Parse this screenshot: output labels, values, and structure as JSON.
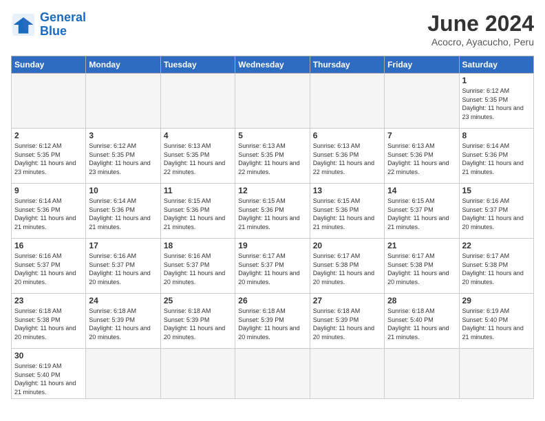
{
  "header": {
    "logo_general": "General",
    "logo_blue": "Blue",
    "title": "June 2024",
    "subtitle": "Acocro, Ayacucho, Peru"
  },
  "days_of_week": [
    "Sunday",
    "Monday",
    "Tuesday",
    "Wednesday",
    "Thursday",
    "Friday",
    "Saturday"
  ],
  "weeks": [
    [
      {
        "day": null,
        "sunrise": null,
        "sunset": null,
        "daylight": null
      },
      {
        "day": null,
        "sunrise": null,
        "sunset": null,
        "daylight": null
      },
      {
        "day": null,
        "sunrise": null,
        "sunset": null,
        "daylight": null
      },
      {
        "day": null,
        "sunrise": null,
        "sunset": null,
        "daylight": null
      },
      {
        "day": null,
        "sunrise": null,
        "sunset": null,
        "daylight": null
      },
      {
        "day": null,
        "sunrise": null,
        "sunset": null,
        "daylight": null
      },
      {
        "day": "1",
        "sunrise": "6:12 AM",
        "sunset": "5:35 PM",
        "daylight": "11 hours and 23 minutes."
      }
    ],
    [
      {
        "day": "2",
        "sunrise": "6:12 AM",
        "sunset": "5:35 PM",
        "daylight": "11 hours and 23 minutes."
      },
      {
        "day": "3",
        "sunrise": "6:12 AM",
        "sunset": "5:35 PM",
        "daylight": "11 hours and 23 minutes."
      },
      {
        "day": "4",
        "sunrise": "6:13 AM",
        "sunset": "5:35 PM",
        "daylight": "11 hours and 22 minutes."
      },
      {
        "day": "5",
        "sunrise": "6:13 AM",
        "sunset": "5:35 PM",
        "daylight": "11 hours and 22 minutes."
      },
      {
        "day": "6",
        "sunrise": "6:13 AM",
        "sunset": "5:36 PM",
        "daylight": "11 hours and 22 minutes."
      },
      {
        "day": "7",
        "sunrise": "6:13 AM",
        "sunset": "5:36 PM",
        "daylight": "11 hours and 22 minutes."
      },
      {
        "day": "8",
        "sunrise": "6:14 AM",
        "sunset": "5:36 PM",
        "daylight": "11 hours and 21 minutes."
      }
    ],
    [
      {
        "day": "9",
        "sunrise": "6:14 AM",
        "sunset": "5:36 PM",
        "daylight": "11 hours and 21 minutes."
      },
      {
        "day": "10",
        "sunrise": "6:14 AM",
        "sunset": "5:36 PM",
        "daylight": "11 hours and 21 minutes."
      },
      {
        "day": "11",
        "sunrise": "6:15 AM",
        "sunset": "5:36 PM",
        "daylight": "11 hours and 21 minutes."
      },
      {
        "day": "12",
        "sunrise": "6:15 AM",
        "sunset": "5:36 PM",
        "daylight": "11 hours and 21 minutes."
      },
      {
        "day": "13",
        "sunrise": "6:15 AM",
        "sunset": "5:36 PM",
        "daylight": "11 hours and 21 minutes."
      },
      {
        "day": "14",
        "sunrise": "6:15 AM",
        "sunset": "5:37 PM",
        "daylight": "11 hours and 21 minutes."
      },
      {
        "day": "15",
        "sunrise": "6:16 AM",
        "sunset": "5:37 PM",
        "daylight": "11 hours and 20 minutes."
      }
    ],
    [
      {
        "day": "16",
        "sunrise": "6:16 AM",
        "sunset": "5:37 PM",
        "daylight": "11 hours and 20 minutes."
      },
      {
        "day": "17",
        "sunrise": "6:16 AM",
        "sunset": "5:37 PM",
        "daylight": "11 hours and 20 minutes."
      },
      {
        "day": "18",
        "sunrise": "6:16 AM",
        "sunset": "5:37 PM",
        "daylight": "11 hours and 20 minutes."
      },
      {
        "day": "19",
        "sunrise": "6:17 AM",
        "sunset": "5:37 PM",
        "daylight": "11 hours and 20 minutes."
      },
      {
        "day": "20",
        "sunrise": "6:17 AM",
        "sunset": "5:38 PM",
        "daylight": "11 hours and 20 minutes."
      },
      {
        "day": "21",
        "sunrise": "6:17 AM",
        "sunset": "5:38 PM",
        "daylight": "11 hours and 20 minutes."
      },
      {
        "day": "22",
        "sunrise": "6:17 AM",
        "sunset": "5:38 PM",
        "daylight": "11 hours and 20 minutes."
      }
    ],
    [
      {
        "day": "23",
        "sunrise": "6:18 AM",
        "sunset": "5:38 PM",
        "daylight": "11 hours and 20 minutes."
      },
      {
        "day": "24",
        "sunrise": "6:18 AM",
        "sunset": "5:39 PM",
        "daylight": "11 hours and 20 minutes."
      },
      {
        "day": "25",
        "sunrise": "6:18 AM",
        "sunset": "5:39 PM",
        "daylight": "11 hours and 20 minutes."
      },
      {
        "day": "26",
        "sunrise": "6:18 AM",
        "sunset": "5:39 PM",
        "daylight": "11 hours and 20 minutes."
      },
      {
        "day": "27",
        "sunrise": "6:18 AM",
        "sunset": "5:39 PM",
        "daylight": "11 hours and 20 minutes."
      },
      {
        "day": "28",
        "sunrise": "6:18 AM",
        "sunset": "5:40 PM",
        "daylight": "11 hours and 21 minutes."
      },
      {
        "day": "29",
        "sunrise": "6:19 AM",
        "sunset": "5:40 PM",
        "daylight": "11 hours and 21 minutes."
      }
    ],
    [
      {
        "day": "30",
        "sunrise": "6:19 AM",
        "sunset": "5:40 PM",
        "daylight": "11 hours and 21 minutes."
      },
      {
        "day": null,
        "sunrise": null,
        "sunset": null,
        "daylight": null
      },
      {
        "day": null,
        "sunrise": null,
        "sunset": null,
        "daylight": null
      },
      {
        "day": null,
        "sunrise": null,
        "sunset": null,
        "daylight": null
      },
      {
        "day": null,
        "sunrise": null,
        "sunset": null,
        "daylight": null
      },
      {
        "day": null,
        "sunrise": null,
        "sunset": null,
        "daylight": null
      },
      {
        "day": null,
        "sunrise": null,
        "sunset": null,
        "daylight": null
      }
    ]
  ]
}
